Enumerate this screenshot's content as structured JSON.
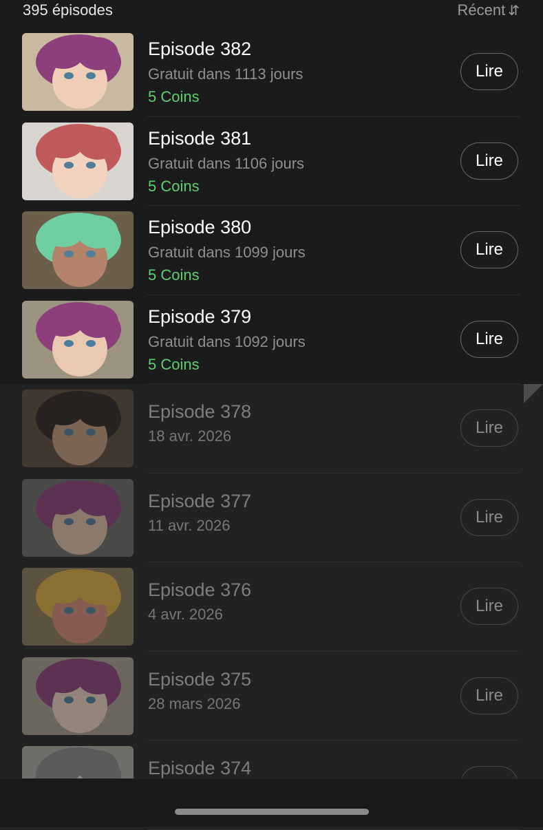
{
  "header": {
    "episode_count": "395 épisodes",
    "sort_label": "Récent",
    "sort_icon": "sort-arrows-icon"
  },
  "episodes": [
    {
      "title": "Episode 382",
      "subtitle": "Gratuit dans 1113 jours",
      "coins": "5 Coins",
      "button": "Lire",
      "palette": [
        "#c9b9a0",
        "#8c3f7a",
        "#f1cfb6"
      ]
    },
    {
      "title": "Episode 381",
      "subtitle": "Gratuit dans 1106 jours",
      "coins": "5 Coins",
      "button": "Lire",
      "palette": [
        "#d8d4cf",
        "#c05a5a",
        "#f2d3c0"
      ]
    },
    {
      "title": "Episode 380",
      "subtitle": "Gratuit dans 1099 jours",
      "coins": "5 Coins",
      "button": "Lire",
      "palette": [
        "#6b5e4a",
        "#6fcf9f",
        "#b5836a"
      ]
    },
    {
      "title": "Episode 379",
      "subtitle": "Gratuit dans 1092 jours",
      "coins": "5 Coins",
      "button": "Lire",
      "palette": [
        "#9c9480",
        "#8c3f7a",
        "#eac9b2"
      ]
    },
    {
      "title": "Episode 378",
      "subtitle": "18 avr. 2026",
      "button": "Lire",
      "palette": [
        "#5a4a3a",
        "#2a2420",
        "#c69a7a"
      ]
    },
    {
      "title": "Episode 377",
      "subtitle": "11 avr. 2026",
      "button": "Lire",
      "palette": [
        "#6c6e6a",
        "#8c3f7a",
        "#e2c0a8"
      ]
    },
    {
      "title": "Episode 376",
      "subtitle": "4 avr. 2026",
      "button": "Lire",
      "palette": [
        "#8a7a5a",
        "#e0b040",
        "#d88a7a"
      ]
    },
    {
      "title": "Episode 375",
      "subtitle": "28 mars 2026",
      "button": "Lire",
      "palette": [
        "#a8a090",
        "#8c3f7a",
        "#f0d6c2"
      ]
    },
    {
      "title": "Episode 374",
      "subtitle": "",
      "button": "",
      "palette": [
        "#b0aca4",
        "#8a8a8a",
        "#e8dcd0"
      ]
    }
  ]
}
